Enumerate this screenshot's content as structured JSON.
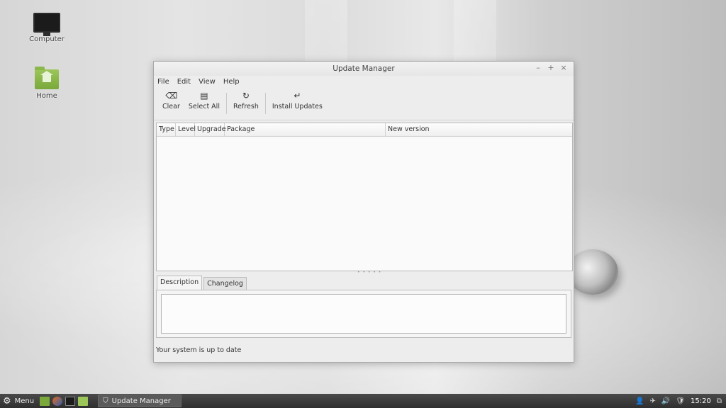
{
  "desktop": {
    "icons": [
      {
        "label": "Computer",
        "icon": "monitor-icon"
      },
      {
        "label": "Home",
        "icon": "home-folder-icon"
      }
    ]
  },
  "window": {
    "title": "Update Manager",
    "controls": {
      "minimize": "–",
      "maximize": "+",
      "close": "×"
    },
    "menu": [
      "File",
      "Edit",
      "View",
      "Help"
    ],
    "toolbar": [
      {
        "label": "Clear",
        "icon": "clear-icon",
        "glyph": "⌫"
      },
      {
        "label": "Select All",
        "icon": "select-all-icon",
        "glyph": "▤"
      },
      {
        "label": "Refresh",
        "icon": "refresh-icon",
        "glyph": "↻"
      },
      {
        "label": "Install Updates",
        "icon": "install-icon",
        "glyph": "↵"
      }
    ],
    "columns": [
      "Type",
      "Level",
      "Upgrade",
      "Package",
      "New version"
    ],
    "tabs": [
      "Description",
      "Changelog"
    ],
    "active_tab": "Description",
    "status": "Your system is up to date"
  },
  "taskbar": {
    "menu_label": "Menu",
    "task_label": "Update Manager",
    "clock": "15:20",
    "colors": {
      "accent": "#7aa83a",
      "taskbar": "#3a3a3a"
    }
  }
}
